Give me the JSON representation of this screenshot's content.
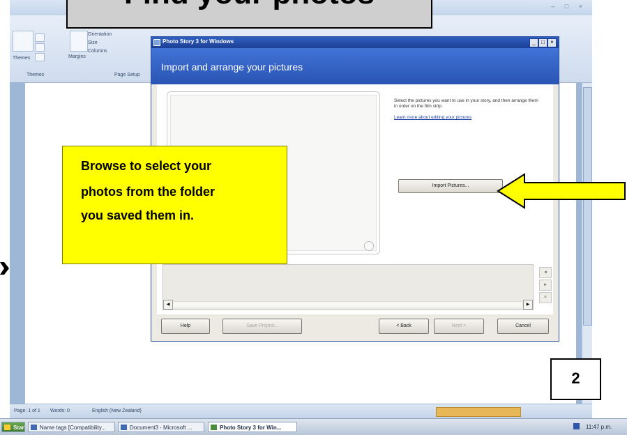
{
  "slide": {
    "title": "Find your photos",
    "callout_lines": [
      "Browse to select your",
      "photos from the folder",
      "you saved them in."
    ],
    "page_number": "2"
  },
  "word": {
    "ribbon": {
      "themes_label": "Themes",
      "margins_label": "Margins",
      "orientation_label": "Orientation",
      "size_label": "Size",
      "columns_label": "Columns",
      "group_themes": "Themes",
      "group_page_setup": "Page Setup"
    },
    "status": {
      "page": "Page: 1 of 1",
      "words": "Words: 0",
      "language": "English (New Zealand)"
    },
    "taskbar": {
      "start_label": "Start",
      "buttons": [
        "Name tags [Compatibility...",
        "Document3 - Microsoft ...",
        "Photo Story 3 for Win..."
      ],
      "clock": "11:47 p.m."
    }
  },
  "dialog": {
    "window_title": "Photo Story 3 for Windows",
    "heading": "Import and arrange your pictures",
    "instructions": "Select the pictures you want to use in your story, and then arrange them in order on the film strip.",
    "learn_more": "Learn more about editing your pictures",
    "import_button": "Import Pictures...",
    "buttons": {
      "help": "Help",
      "save_project": "Save Project...",
      "back": "< Back",
      "next": "Next >",
      "cancel": "Cancel"
    }
  },
  "colors": {
    "callout_fill": "#ffff00",
    "arrow_fill": "#ffff00",
    "dialog_header": "#2f5fc2"
  }
}
